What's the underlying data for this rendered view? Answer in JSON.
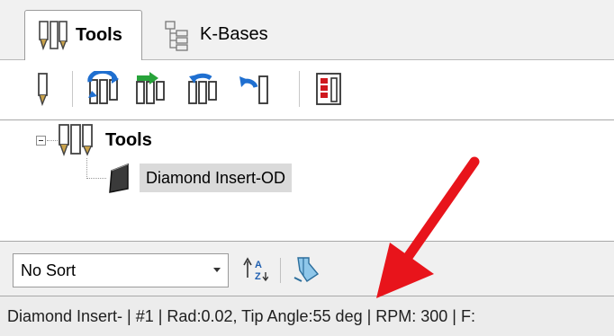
{
  "tabs": [
    {
      "label": "Tools",
      "icon": "tools-icon",
      "active": true
    },
    {
      "label": "K-Bases",
      "icon": "k-bases-icon",
      "active": false
    }
  ],
  "toolbar": {
    "buttons": [
      {
        "name": "new-tool-button",
        "icon": "tool-icon"
      },
      {
        "name": "refresh-tools-button",
        "icon": "refresh-tools-icon"
      },
      {
        "name": "import-tools-button",
        "icon": "import-tools-icon"
      },
      {
        "name": "export-tools-button",
        "icon": "export-tools-icon"
      },
      {
        "name": "undo-tool-button",
        "icon": "undo-tool-icon"
      },
      {
        "name": "tool-report-button",
        "icon": "tool-report-icon"
      }
    ]
  },
  "tree": {
    "root": {
      "label": "Tools",
      "expanded": true
    },
    "children": [
      {
        "label": "Diamond Insert-OD",
        "selected": true
      }
    ]
  },
  "sortbar": {
    "selected": "No Sort",
    "sort_button_icon": "sort-az-icon",
    "tool_button_icon": "tool-filter-icon"
  },
  "status": {
    "text": "Diamond Insert- | #1 | Rad:0.02, Tip Angle:55 deg | RPM: 300 | F:"
  },
  "colors": {
    "arrow": "#e8141b",
    "selection": "#dadada",
    "toolbar_blue": "#1f6fd0",
    "toolbar_green": "#27a33a",
    "report_red": "#d0181e"
  }
}
